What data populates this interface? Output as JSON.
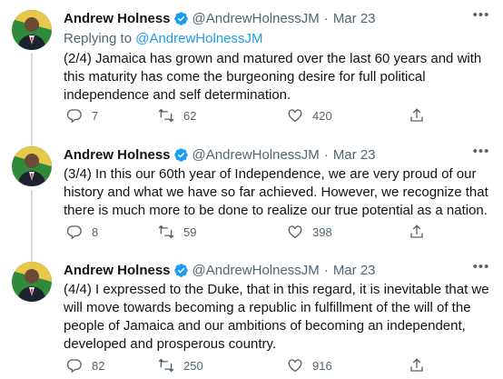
{
  "tweets": [
    {
      "author": "Andrew Holness",
      "handle": "@AndrewHolnessJM",
      "separator": "·",
      "date": "Mar 23",
      "replying_prefix": "Replying to ",
      "replying_handle": "@AndrewHolnessJM",
      "text": "(2/4) Jamaica has grown and matured over the last 60 years and with this maturity has come the burgeoning desire for full political independence and self determination.",
      "replies": "7",
      "retweets": "62",
      "likes": "420"
    },
    {
      "author": "Andrew Holness",
      "handle": "@AndrewHolnessJM",
      "separator": "·",
      "date": "Mar 23",
      "text": "(3/4) In this our 60th year of Independence, we are very proud of our history and what we have so far achieved. However, we recognize that there is much more to be done to realize our true potential as a nation.",
      "replies": "8",
      "retweets": "59",
      "likes": "398"
    },
    {
      "author": "Andrew Holness",
      "handle": "@AndrewHolnessJM",
      "separator": "·",
      "date": "Mar 23",
      "text": "(4/4) I expressed to the Duke, that in this regard, it is inevitable that we will move towards becoming a republic in fulfillment of the will of the people of Jamaica and our ambitions of becoming an independent, developed and prosperous country.",
      "replies": "82",
      "retweets": "250",
      "likes": "916"
    }
  ],
  "icons": {
    "more": "more-icon",
    "verified": "verified-badge-icon",
    "reply": "reply-icon",
    "retweet": "retweet-icon",
    "like": "heart-icon",
    "share": "share-icon"
  },
  "colors": {
    "accent": "#1d9bf0",
    "text": "#0f1419",
    "secondary": "#536471",
    "thread_line": "#cfd9de"
  }
}
